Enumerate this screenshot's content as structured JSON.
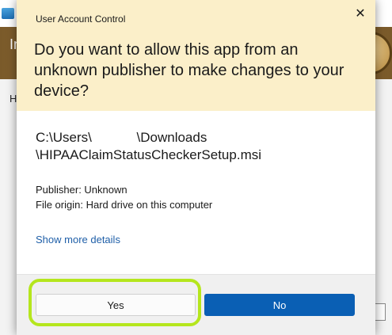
{
  "dialog": {
    "title": "User Account Control",
    "close_glyph": "✕",
    "question": "Do you want to allow this app from an unknown publisher to make changes to your device?",
    "path_line1": "C:\\Users\\            \\Downloads",
    "path_line2": "\\HIPAAClaimStatusCheckerSetup.msi",
    "publisher_line": "Publisher: Unknown",
    "origin_line": "File origin: Hard drive on this computer",
    "more_details": "Show more details",
    "yes_label": "Yes",
    "no_label": "No"
  },
  "background": {
    "banner_text": "In",
    "body_text": "H"
  },
  "colors": {
    "header_bg": "#fbefc9",
    "primary_button": "#0a5fb4",
    "link": "#1f5fa8",
    "highlight_ring": "#b5e61d"
  },
  "icons": {
    "close": "close-icon",
    "app": "app-icon"
  }
}
